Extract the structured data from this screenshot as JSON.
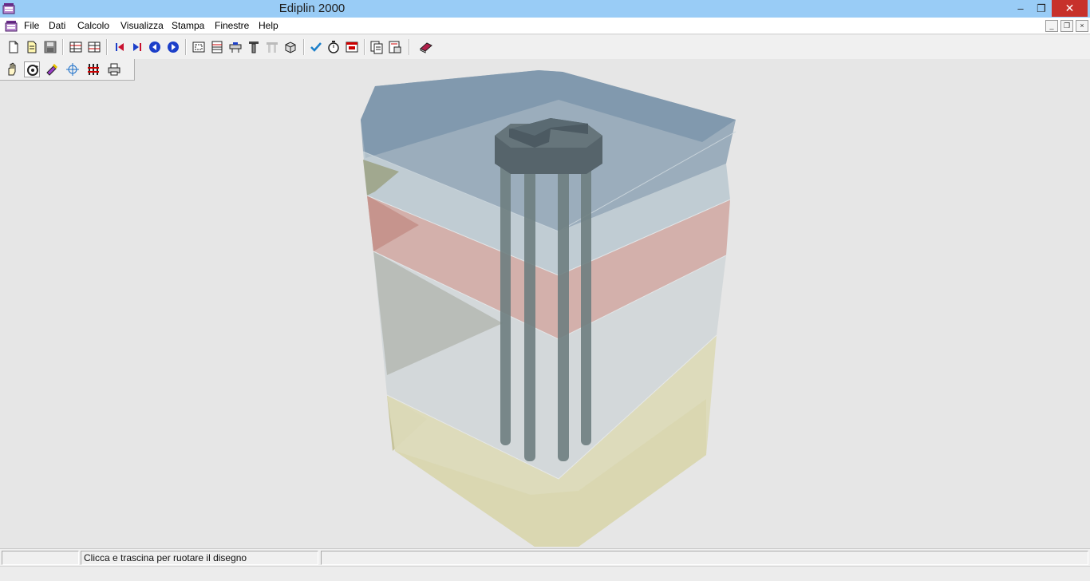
{
  "window": {
    "title": "Ediplin 2000",
    "minimize_glyph": "–",
    "maximize_glyph": "❐",
    "close_glyph": "✕"
  },
  "menu": {
    "items": [
      "File",
      "Dati",
      "Calcolo",
      "Visualizza",
      "Stampa",
      "Finestre",
      "Help"
    ],
    "mdi_minimize": "_",
    "mdi_restore": "❐",
    "mdi_close": "×"
  },
  "toolbar": {
    "buttons": [
      "new-file-icon",
      "open-file-icon",
      "save-icon",
      "data-grid-icon",
      "data-grid-2-icon",
      "first-icon",
      "last-icon",
      "previous-icon",
      "next-icon",
      "zoom-extents-icon",
      "table-icon",
      "section-icon",
      "pile-icon",
      "piles-disabled-icon",
      "3d-view-icon",
      "check-icon",
      "timer-icon",
      "report-icon",
      "copy-pages-icon",
      "print-preview-icon",
      "book-icon"
    ]
  },
  "toolbar2": {
    "buttons": [
      "pan-hand-icon",
      "rotate-icon",
      "zoom-brush-icon",
      "crosshair-icon",
      "layers-icon",
      "printer-icon"
    ]
  },
  "colors": {
    "titlebar": "#99ccf6",
    "close_button": "#c7312b",
    "top_layer": "#7f98ad",
    "red_layer": "#c99b96",
    "olive_layer": "#a0a58a",
    "yellow_layer": "#d9d7b0",
    "pile": "#6e7e80",
    "cap": "#56646b"
  },
  "status": {
    "pane1": "",
    "pane2": "Clicca e trascina per ruotare il disegno",
    "pane3": ""
  }
}
